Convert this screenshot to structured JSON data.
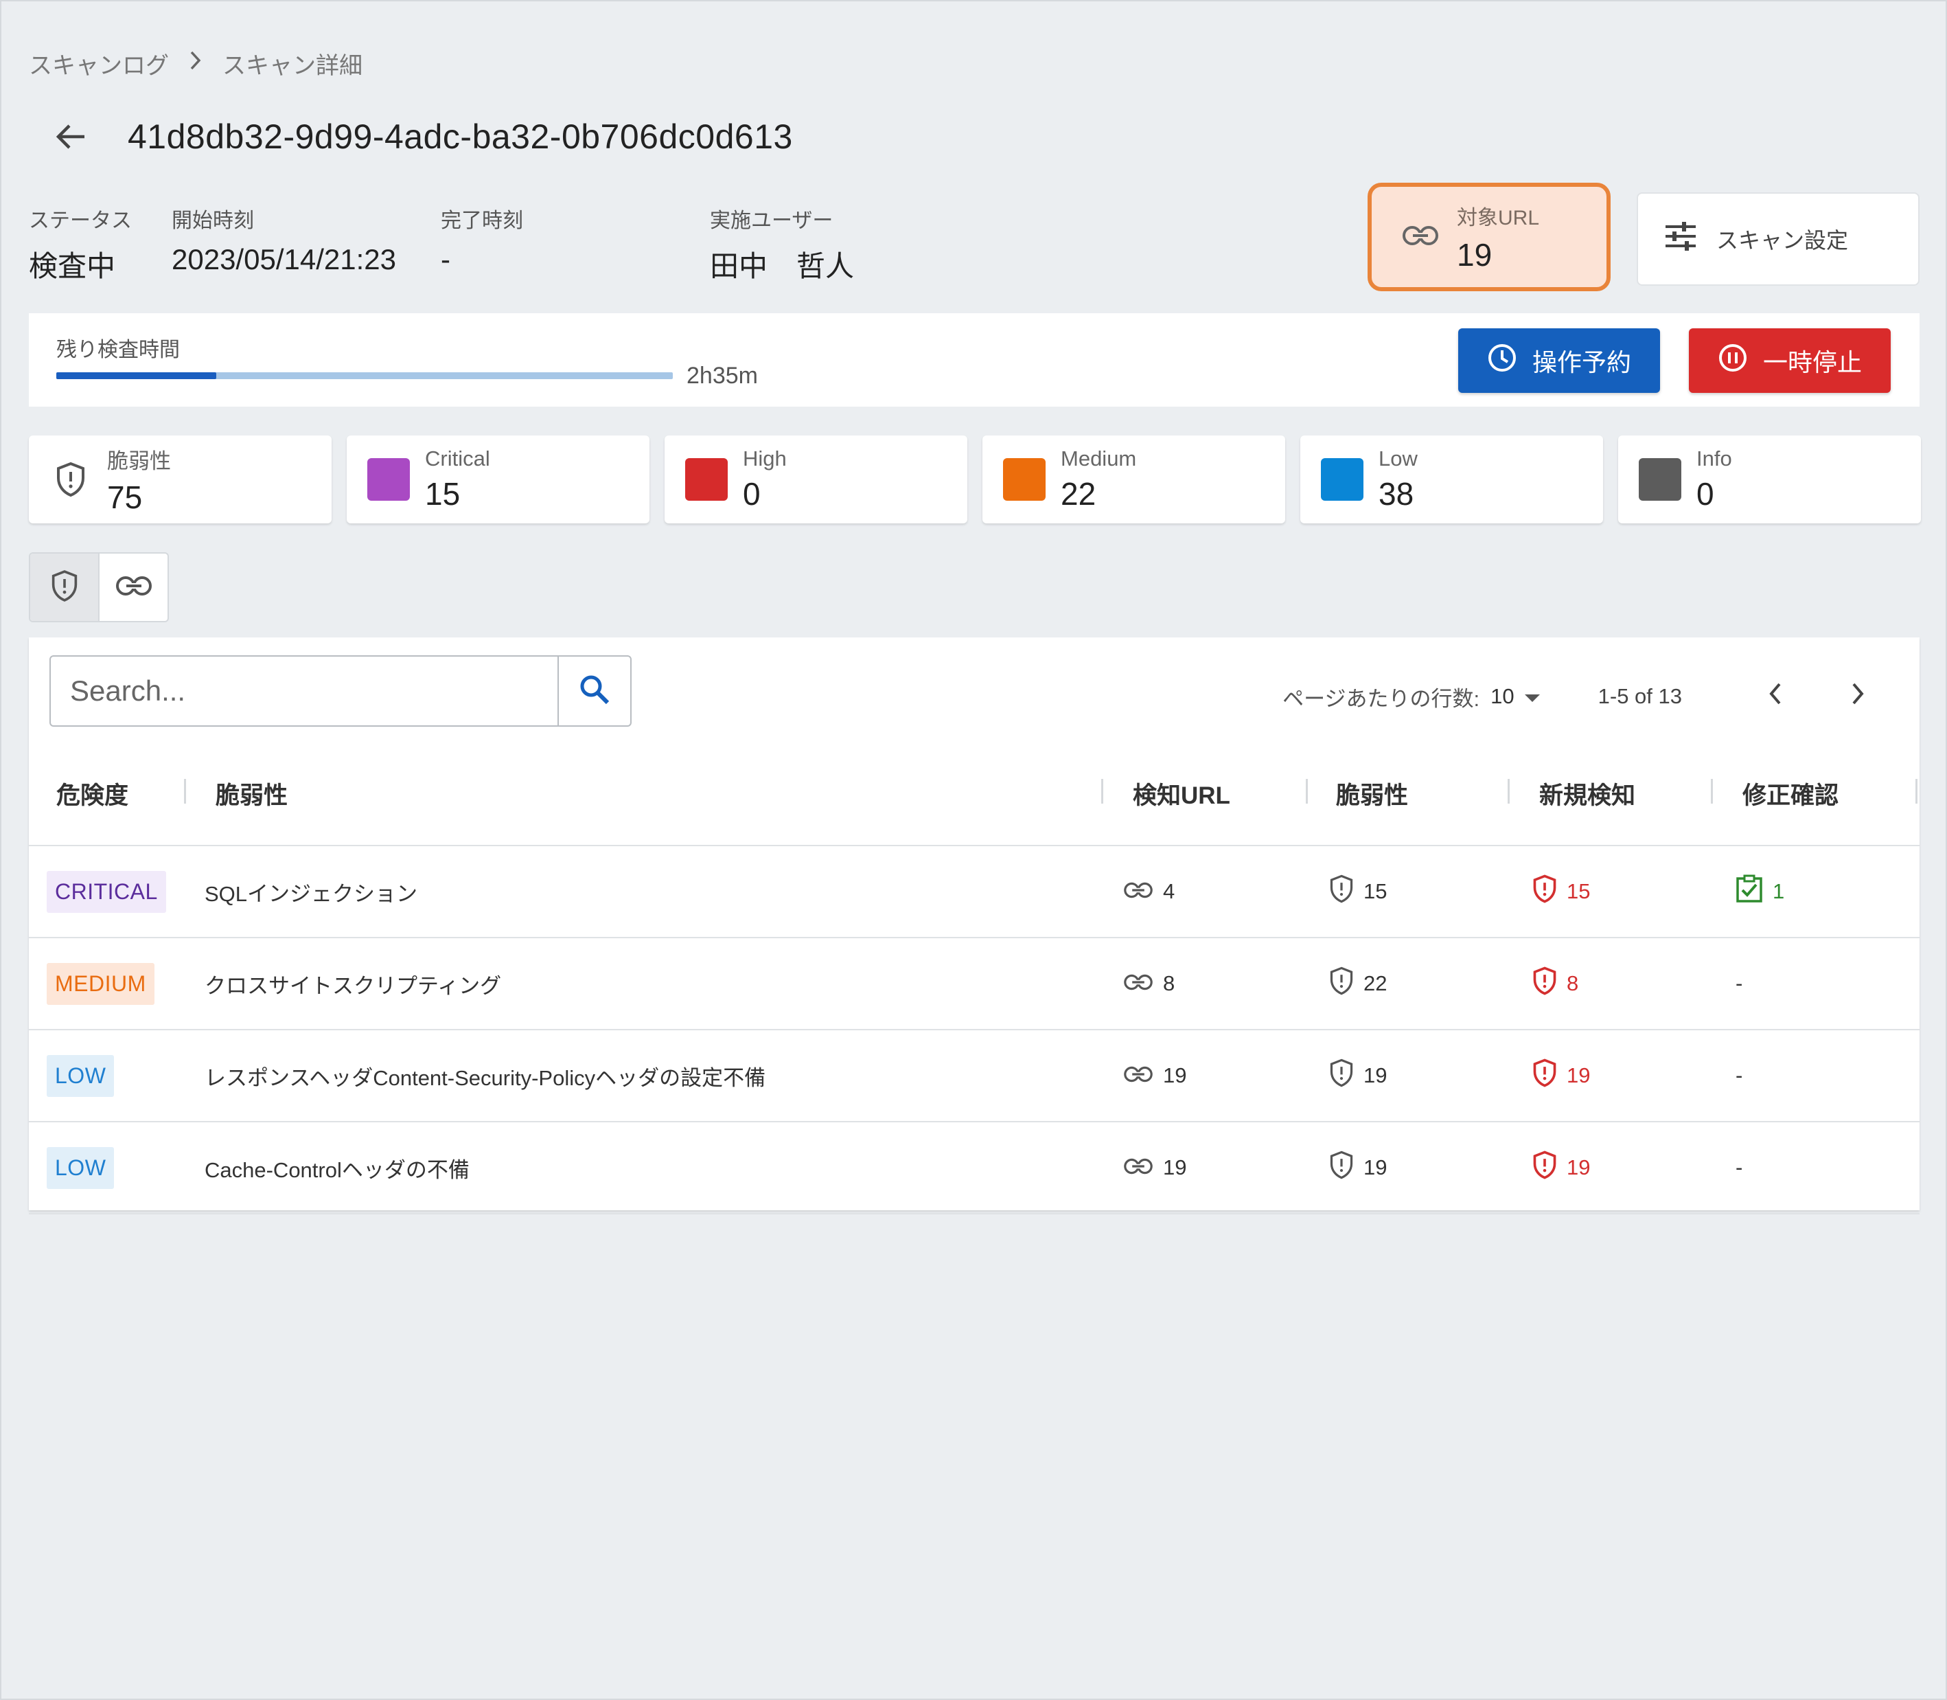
{
  "breadcrumb": {
    "items": [
      "スキャンログ",
      "スキャン詳細"
    ]
  },
  "page": {
    "title": "41d8db32-9d99-4adc-ba32-0b706dc0d613"
  },
  "meta": {
    "status_label": "ステータス",
    "status_value": "検査中",
    "start_label": "開始時刻",
    "start_value": "2023/05/14/21:23",
    "end_label": "完了時刻",
    "end_value": "-",
    "user_label": "実施ユーザー",
    "user_value": "田中　哲人"
  },
  "target_url": {
    "label": "対象URL",
    "value": "19",
    "icon": "link-icon"
  },
  "settings": {
    "label": "スキャン設定",
    "icon": "tune-icon"
  },
  "progress": {
    "label": "残り検査時間",
    "remaining": "2h35m",
    "fraction": 0.26
  },
  "actions": {
    "schedule_label": "操作予約",
    "pause_label": "一時停止"
  },
  "stats": [
    {
      "label": "脆弱性",
      "value": "75",
      "icon": "shield-icon"
    },
    {
      "label": "Critical",
      "value": "15",
      "color": "#a94ac3"
    },
    {
      "label": "High",
      "value": "0",
      "color": "#d62b2b"
    },
    {
      "label": "Medium",
      "value": "22",
      "color": "#ec6d0c"
    },
    {
      "label": "Low",
      "value": "38",
      "color": "#0a86d6"
    },
    {
      "label": "Info",
      "value": "0",
      "color": "#5c5c5c"
    }
  ],
  "search": {
    "placeholder": "Search..."
  },
  "pagination": {
    "rows_label": "ページあたりの行数:",
    "rows_value": "10",
    "range": "1-5 of 13"
  },
  "table": {
    "headers": [
      "危険度",
      "脆弱性",
      "検知URL",
      "脆弱性",
      "新規検知",
      "修正確認"
    ],
    "rows": [
      {
        "severity": "CRITICAL",
        "name": "SQLインジェクション",
        "urls": "4",
        "vulns": "15",
        "new": "15",
        "fixed": "1"
      },
      {
        "severity": "MEDIUM",
        "name": "クロスサイトスクリプティング",
        "urls": "8",
        "vulns": "22",
        "new": "8",
        "fixed": "-"
      },
      {
        "severity": "LOW",
        "name": "レスポンスヘッダContent-Security-Policyヘッダの設定不備",
        "urls": "19",
        "vulns": "19",
        "new": "19",
        "fixed": "-"
      },
      {
        "severity": "LOW",
        "name": "Cache-Controlヘッダの不備",
        "urls": "19",
        "vulns": "19",
        "new": "19",
        "fixed": "-"
      }
    ]
  },
  "colors": {
    "primary": "#1560bd",
    "danger": "#d92b2b",
    "highlight": "#e9843a"
  }
}
